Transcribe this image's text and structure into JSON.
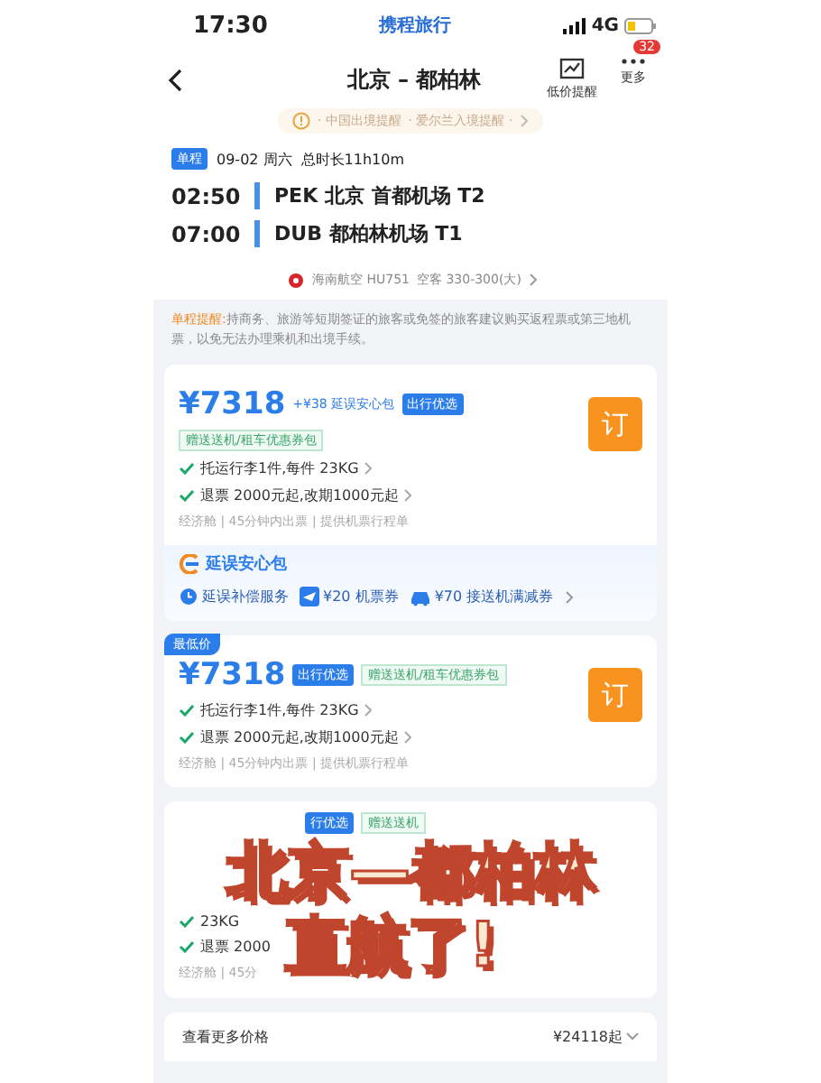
{
  "status_bar": {
    "time": "17:30",
    "app_name": "携程旅行",
    "network": "4G"
  },
  "nav": {
    "title": "北京 – 都柏林",
    "actions": [
      {
        "kind": "chart",
        "label": "低价提醒"
      },
      {
        "kind": "more",
        "label": "更多",
        "badge": "32"
      }
    ]
  },
  "notice": {
    "items": [
      "· 中国出境提醒",
      "· 爱尔兰入境提醒 ·"
    ]
  },
  "flight": {
    "trip_tag": "单程",
    "date": "09-02 周六",
    "duration": "总时长11h10m",
    "segments": [
      {
        "time": "02:50",
        "airport": "PEK 北京 首都机场 T2"
      },
      {
        "time": "07:00",
        "airport": "DUB 都柏林机场 T1"
      }
    ],
    "airline": "海南航空 HU751",
    "aircraft": "空客 330-300(大)"
  },
  "reminder": {
    "label": "单程提醒:",
    "text": "持商务、旅游等短期签证的旅客或免签的旅客建议购买返程票或第三地机票，以免无法办理乘机和出境手续。"
  },
  "offers": [
    {
      "kind": "standard",
      "price": "¥7318",
      "addon": "+¥38 延误安心包",
      "tag": "出行优选",
      "coupon": "赠送送机/租车优惠券包",
      "perks": [
        "托运行李1件,每件 23KG",
        "退票 2000元起,改期1000元起"
      ],
      "meta": "经济舱 | 45分钟内出票 | 提供机票行程单",
      "book": "订",
      "package": {
        "title": "延误安心包",
        "items": [
          {
            "kind": "delay",
            "label": "延误补偿服务"
          },
          {
            "kind": "ticket",
            "label": "¥20 机票券"
          },
          {
            "kind": "car",
            "label": "¥70 接送机满减券"
          }
        ]
      }
    },
    {
      "kind": "standard",
      "badge": "最低价",
      "price": "¥7318",
      "tag": "出行优选",
      "coupon": "赠送送机/租车优惠券包",
      "perks": [
        "托运行李1件,每件 23KG",
        "退票 2000元起,改期1000元起"
      ],
      "meta": "经济舱 | 45分钟内出票 | 提供机票行程单",
      "book": "订"
    },
    {
      "kind": "covered",
      "tag": "行优选",
      "coupon": "赠送送机",
      "perks": [
        "23KG",
        "退票 2000"
      ],
      "meta": "经济舱 | 45分"
    }
  ],
  "more_prices": {
    "label": "查看更多价格",
    "price": "¥24118起"
  },
  "caption": {
    "lines": [
      "北京—都柏林",
      "直航了!"
    ]
  }
}
